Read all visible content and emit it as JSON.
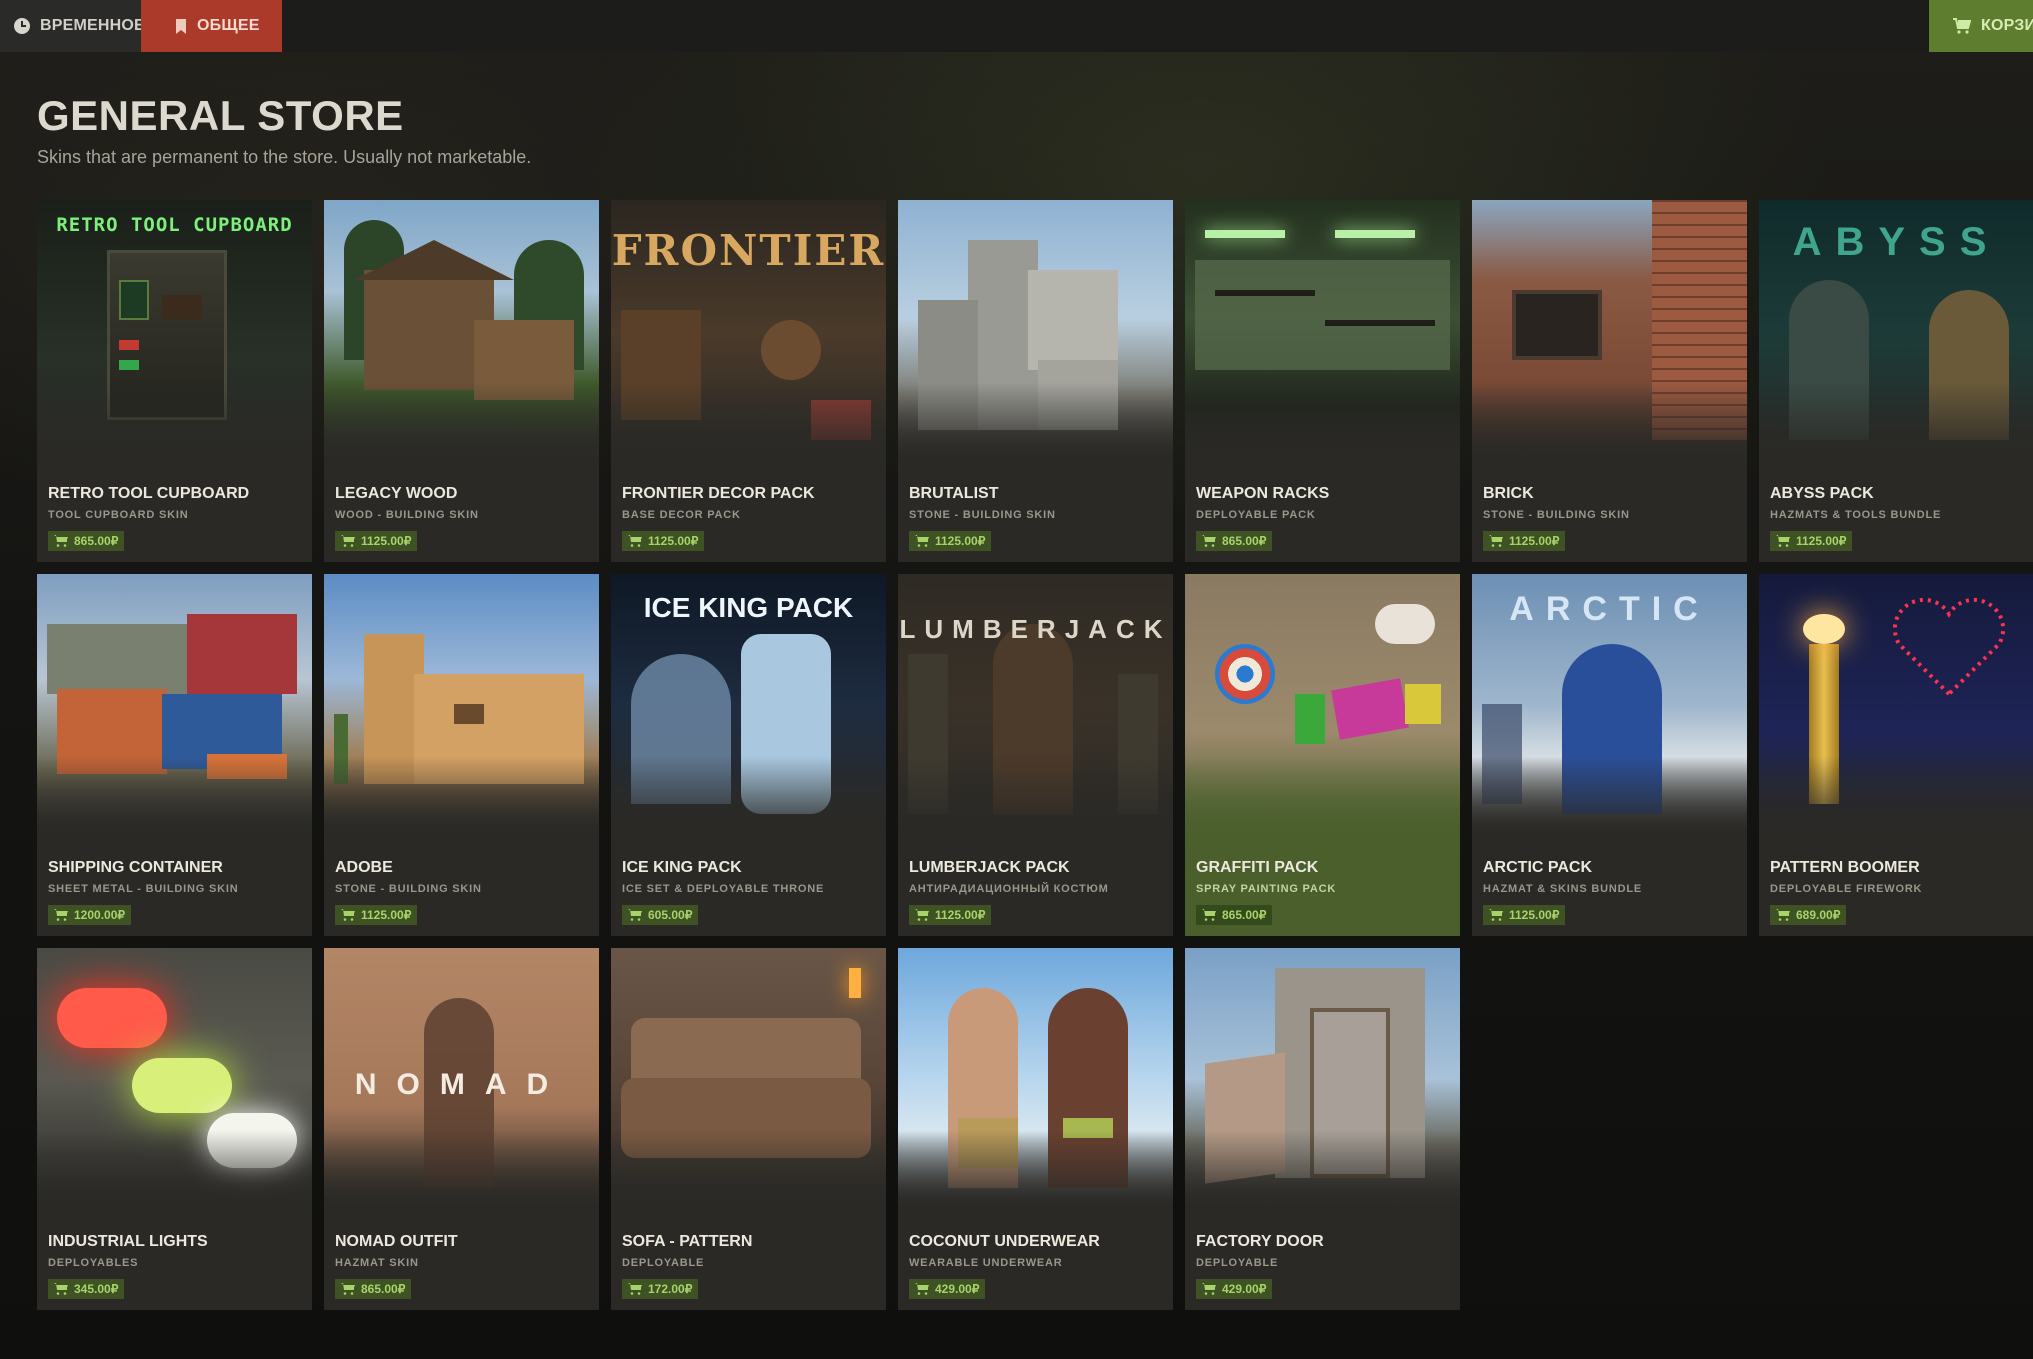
{
  "topbar": {
    "tab_temporary": "ВРЕМЕННОЕ",
    "tab_general": "ОБЩЕЕ",
    "cart_label": "КОРЗИН"
  },
  "header": {
    "title": "GENERAL STORE",
    "subtitle": "Skins that are permanent to the store. Usually not marketable."
  },
  "colors": {
    "accent_red": "#ab3a2a",
    "accent_green": "#5e7d2f",
    "price_text": "#a8d36a"
  },
  "items": [
    {
      "name": "RETRO TOOL CUPBOARD",
      "type": "TOOL CUPBOARD SKIN",
      "price": "865.00₽",
      "art_text": "RETRO TOOL CUPBOARD"
    },
    {
      "name": "LEGACY WOOD",
      "type": "WOOD - BUILDING SKIN",
      "price": "1125.00₽"
    },
    {
      "name": "FRONTIER DECOR PACK",
      "type": "BASE DECOR PACK",
      "price": "1125.00₽",
      "art_text": "FRONTIER"
    },
    {
      "name": "BRUTALIST",
      "type": "STONE - BUILDING SKIN",
      "price": "1125.00₽"
    },
    {
      "name": "WEAPON RACKS",
      "type": "DEPLOYABLE PACK",
      "price": "865.00₽"
    },
    {
      "name": "BRICK",
      "type": "STONE - BUILDING SKIN",
      "price": "1125.00₽"
    },
    {
      "name": "ABYSS PACK",
      "type": "HAZMATS & TOOLS BUNDLE",
      "price": "1125.00₽",
      "art_text": "ABYSS"
    },
    {
      "name": "SHIPPING CONTAINER",
      "type": "SHEET METAL - BUILDING SKIN",
      "price": "1200.00₽"
    },
    {
      "name": "ADOBE",
      "type": "STONE - BUILDING SKIN",
      "price": "1125.00₽"
    },
    {
      "name": "ICE KING PACK",
      "type": "ICE SET & DEPLOYABLE THRONE",
      "price": "605.00₽",
      "art_text": "ICE KING PACK"
    },
    {
      "name": "LUMBERJACK PACK",
      "type": "АНТИРАДИАЦИОННЫЙ КОСТЮМ",
      "price": "1125.00₽",
      "art_text": "LUMBERJACK"
    },
    {
      "name": "GRAFFITI PACK",
      "type": "SPRAY PAINTING PACK",
      "price": "865.00₽"
    },
    {
      "name": "ARCTIC PACK",
      "type": "HAZMAT & SKINS BUNDLE",
      "price": "1125.00₽",
      "art_text": "ARCTIC"
    },
    {
      "name": "PATTERN BOOMER",
      "type": "DEPLOYABLE FIREWORK",
      "price": "689.00₽"
    },
    {
      "name": "INDUSTRIAL LIGHTS",
      "type": "DEPLOYABLES",
      "price": "345.00₽"
    },
    {
      "name": "NOMAD OUTFIT",
      "type": "HAZMAT SKIN",
      "price": "865.00₽",
      "art_text": "NOMAD"
    },
    {
      "name": "SOFA - PATTERN",
      "type": "DEPLOYABLE",
      "price": "172.00₽"
    },
    {
      "name": "COCONUT UNDERWEAR",
      "type": "WEARABLE UNDERWEAR",
      "price": "429.00₽"
    },
    {
      "name": "FACTORY DOOR",
      "type": "DEPLOYABLE",
      "price": "429.00₽"
    }
  ]
}
